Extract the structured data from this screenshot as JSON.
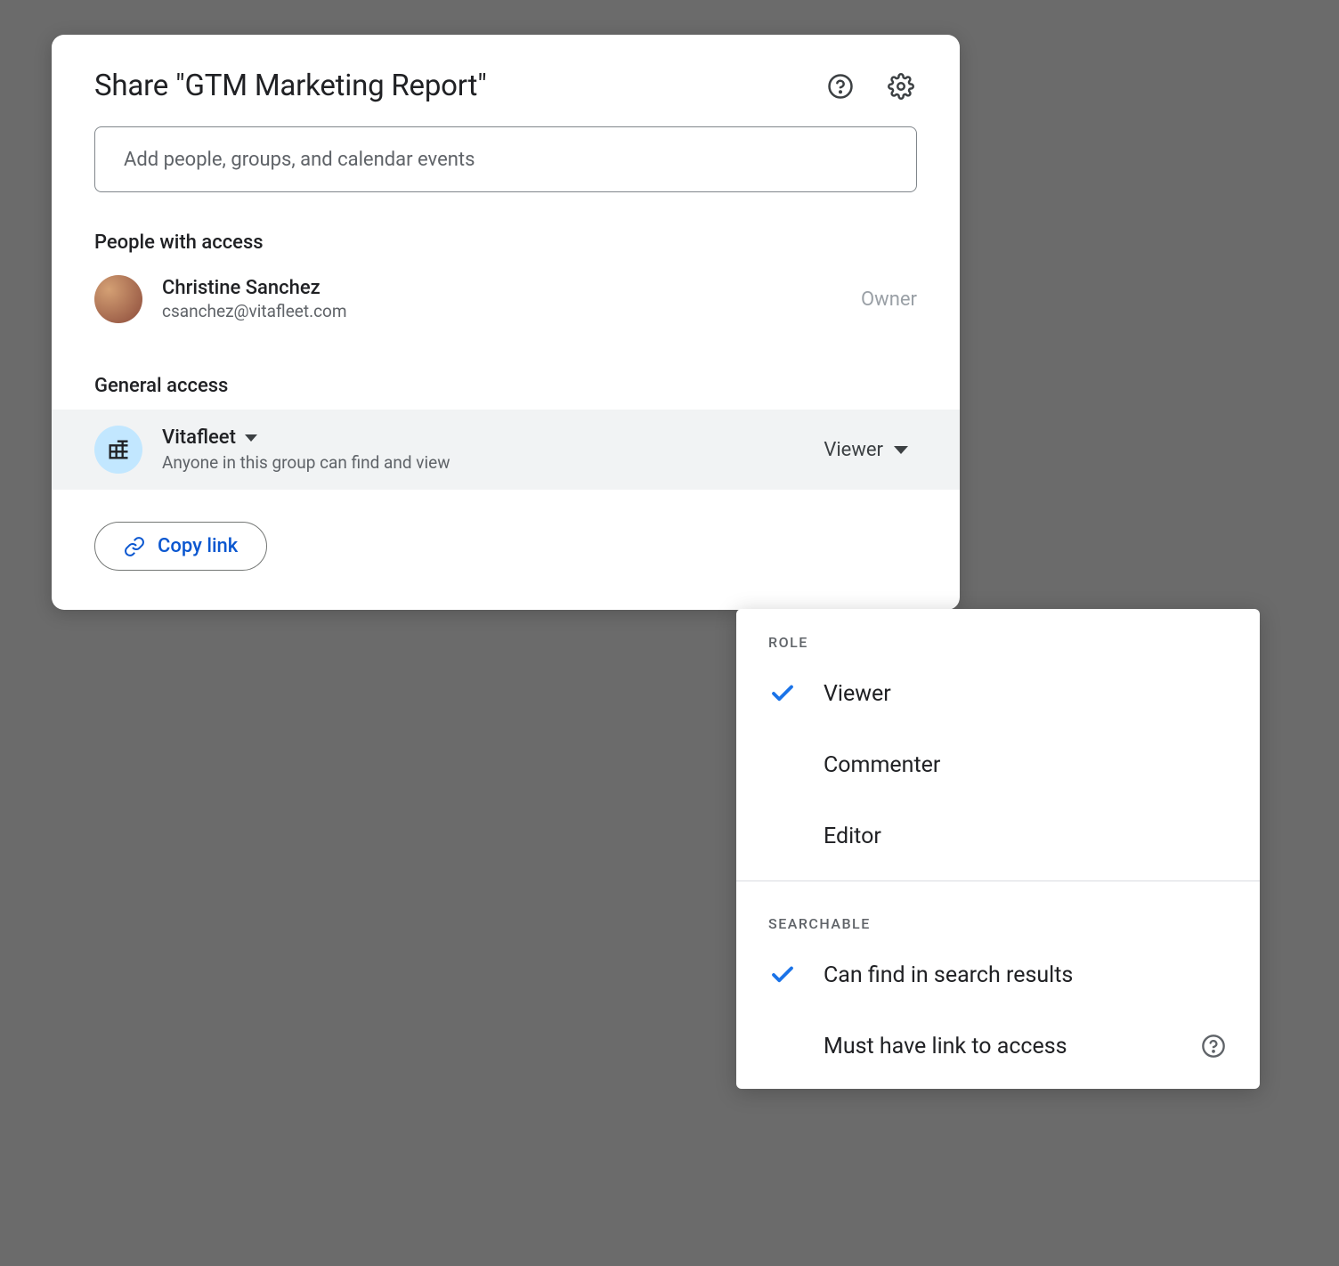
{
  "dialog": {
    "title": "Share \"GTM Marketing Report\"",
    "add_people_placeholder": "Add people, groups, and calendar events",
    "people_section_label": "People with access",
    "people": [
      {
        "name": "Christine Sanchez",
        "email": "csanchez@vitafleet.com",
        "role": "Owner"
      }
    ],
    "general_section_label": "General access",
    "general": {
      "org_name": "Vitafleet",
      "org_desc": "Anyone in this group can find and view",
      "selected_role": "Viewer"
    },
    "copy_link_label": "Copy link"
  },
  "dropdown": {
    "role_label": "ROLE",
    "roles": [
      {
        "label": "Viewer",
        "checked": true
      },
      {
        "label": "Commenter",
        "checked": false
      },
      {
        "label": "Editor",
        "checked": false
      }
    ],
    "searchable_label": "SEARCHABLE",
    "searchable": [
      {
        "label": "Can find in search results",
        "checked": true,
        "help": false
      },
      {
        "label": "Must have link to access",
        "checked": false,
        "help": true
      }
    ]
  }
}
